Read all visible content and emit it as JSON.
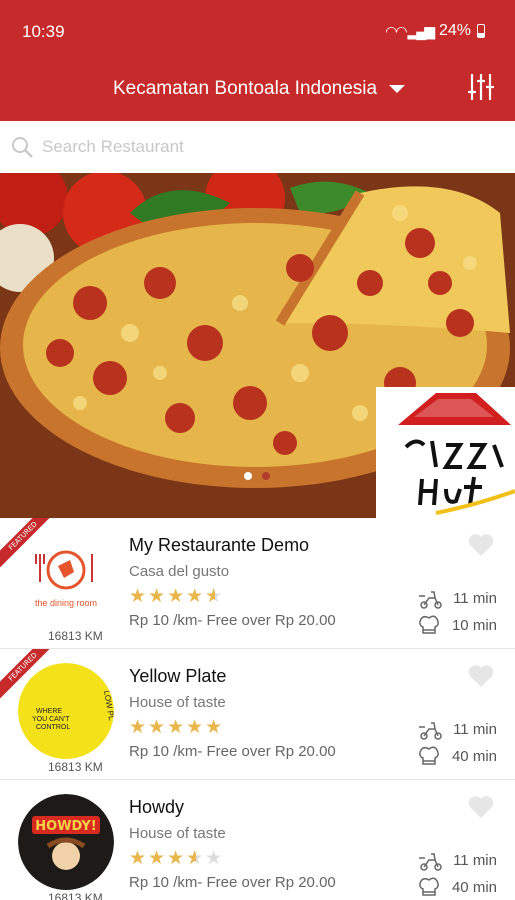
{
  "status": {
    "time": "10:39",
    "battery": "24%"
  },
  "header": {
    "location": "Kecamatan Bontoala Indonesia"
  },
  "search": {
    "placeholder": "Search Restaurant"
  },
  "banner": {
    "brand": "Pizza Hut",
    "slides": 2,
    "active_slide": 1
  },
  "colors": {
    "primary": "#c62a2a",
    "star": "#e8b64a"
  },
  "restaurants": [
    {
      "name": "My Restaurante Demo",
      "subtitle": "Casa del gusto",
      "rating": 4.5,
      "fee": "Rp 10 /km- Free over Rp 20.00",
      "distance": "16813 KM",
      "delivery_time": "11 min",
      "prep_time": "10 min",
      "featured": true,
      "badge": "FEATURED",
      "logo": "the dining room"
    },
    {
      "name": "Yellow Plate",
      "subtitle": "House of taste",
      "rating": 5,
      "fee": "Rp 10 /km- Free over Rp 20.00",
      "distance": "16813 KM",
      "delivery_time": "11 min",
      "prep_time": "40 min",
      "featured": true,
      "badge": "FEATURED",
      "logo": "yellow plate"
    },
    {
      "name": "Howdy",
      "subtitle": "House of taste",
      "rating": 3.5,
      "fee": "Rp 10 /km- Free over Rp 20.00",
      "distance": "16813 KM",
      "delivery_time": "11 min",
      "prep_time": "40 min",
      "featured": false,
      "badge": "",
      "logo": "HOWDY!"
    }
  ]
}
